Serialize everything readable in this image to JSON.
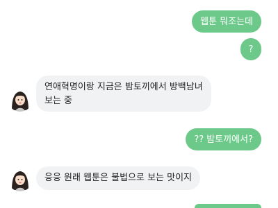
{
  "messages": [
    {
      "side": "out",
      "text": "웹툰 뭐조는데"
    },
    {
      "side": "out",
      "text": "?"
    },
    {
      "side": "in",
      "lines": [
        "연애혁명이랑 지금은 밤토끼에서 방백남녀",
        "보는 중"
      ]
    },
    {
      "side": "out",
      "text": "?? 밤토끼에서?"
    },
    {
      "side": "in",
      "lines": [
        "응응 원래 웹툰은 불법으로 보는 맛이지"
      ]
    },
    {
      "side": "out",
      "text": ""
    }
  ],
  "colors": {
    "outgoing_bubble": "#6cc98a",
    "incoming_bubble": "#f1f2f4"
  },
  "icons": {
    "avatar": "girl-avatar-icon"
  }
}
